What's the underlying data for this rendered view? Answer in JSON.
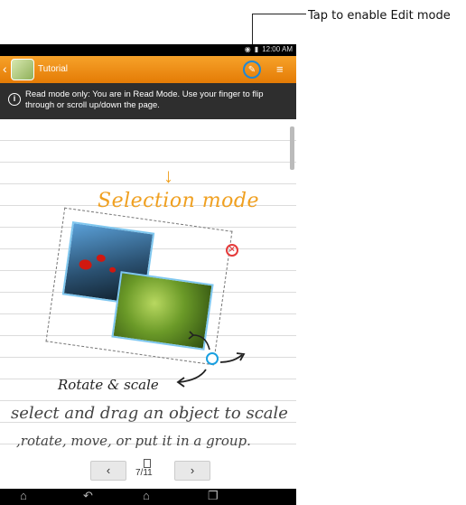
{
  "callout": {
    "text": "Tap to enable Edit mode"
  },
  "status_bar": {
    "time": "12:00 AM",
    "wifi_icon": "wifi-icon",
    "battery_icon": "battery-icon"
  },
  "action_bar": {
    "title": "Tutorial",
    "back_icon": "chevron-left-icon",
    "edit_icon": "pen-icon",
    "menu_icon": "menu-icon"
  },
  "info_bar": {
    "icon": "info-icon",
    "text": "Read mode only: You are in Read Mode. Use your finger to flip through or scroll up/down the page."
  },
  "page": {
    "arrow": "↓",
    "heading": "Selection mode",
    "caption": "Rotate & scale",
    "handwriting_line1": "select and drag an object to scale",
    "handwriting_line2": ",rotate, move, or put it in a group."
  },
  "pager": {
    "prev": "‹",
    "next": "›",
    "page": "7/11"
  },
  "nav_bar": {
    "back_icon": "back-icon",
    "home_icon": "home-icon",
    "recent_icon": "recent-apps-icon",
    "collapse_icon": "collapse-icon"
  },
  "colors": {
    "accent": "#f0a020",
    "action_bar": "#e47b05",
    "selection": "#1aa0e0",
    "close": "#e53a3a"
  }
}
